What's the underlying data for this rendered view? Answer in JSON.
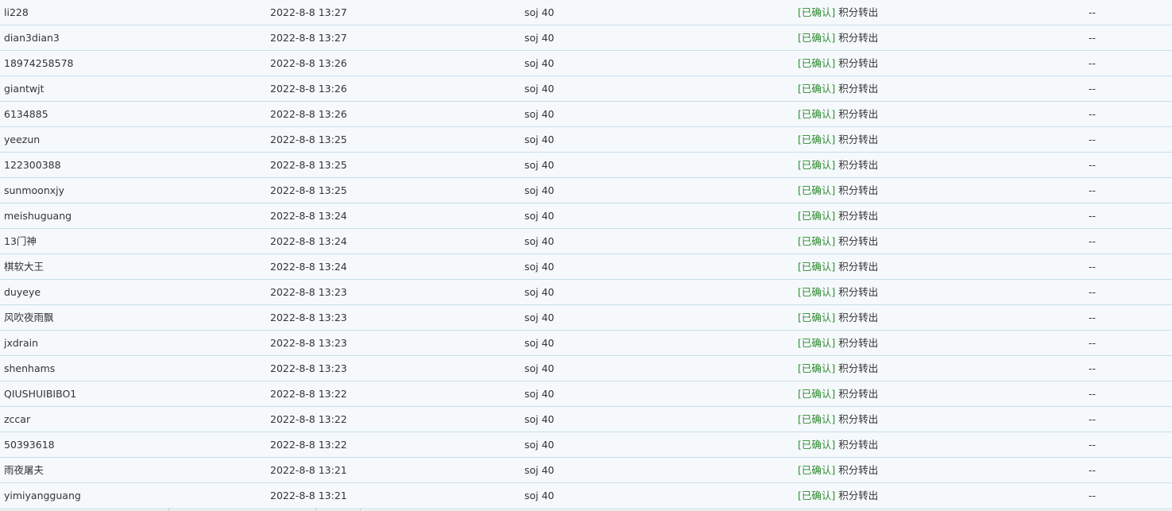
{
  "status_tag": "[已确认]",
  "status_type": "积分转出",
  "rows": [
    {
      "user": "li228",
      "time": "2022-8-8 13:27",
      "amount": "soj 40",
      "extra": "--"
    },
    {
      "user": "dian3dian3",
      "time": "2022-8-8 13:27",
      "amount": "soj 40",
      "extra": "--"
    },
    {
      "user": "18974258578",
      "time": "2022-8-8 13:26",
      "amount": "soj 40",
      "extra": "--"
    },
    {
      "user": "giantwjt",
      "time": "2022-8-8 13:26",
      "amount": "soj 40",
      "extra": "--"
    },
    {
      "user": "6134885",
      "time": "2022-8-8 13:26",
      "amount": "soj 40",
      "extra": "--"
    },
    {
      "user": "yeezun",
      "time": "2022-8-8 13:25",
      "amount": "soj 40",
      "extra": "--"
    },
    {
      "user": "122300388",
      "time": "2022-8-8 13:25",
      "amount": "soj 40",
      "extra": "--"
    },
    {
      "user": "sunmoonxjy",
      "time": "2022-8-8 13:25",
      "amount": "soj 40",
      "extra": "--"
    },
    {
      "user": "meishuguang",
      "time": "2022-8-8 13:24",
      "amount": "soj 40",
      "extra": "--"
    },
    {
      "user": "13门神",
      "time": "2022-8-8 13:24",
      "amount": "soj 40",
      "extra": "--"
    },
    {
      "user": "棋软大王",
      "time": "2022-8-8 13:24",
      "amount": "soj 40",
      "extra": "--"
    },
    {
      "user": "duyeye",
      "time": "2022-8-8 13:23",
      "amount": "soj 40",
      "extra": "--"
    },
    {
      "user": "风吹夜雨飘",
      "time": "2022-8-8 13:23",
      "amount": "soj 40",
      "extra": "--"
    },
    {
      "user": "jxdrain",
      "time": "2022-8-8 13:23",
      "amount": "soj 40",
      "extra": "--"
    },
    {
      "user": "shenhams",
      "time": "2022-8-8 13:23",
      "amount": "soj 40",
      "extra": "--"
    },
    {
      "user": "QIUSHUIBIBO1",
      "time": "2022-8-8 13:22",
      "amount": "soj 40",
      "extra": "--"
    },
    {
      "user": "zccar",
      "time": "2022-8-8 13:22",
      "amount": "soj 40",
      "extra": "--"
    },
    {
      "user": "50393618",
      "time": "2022-8-8 13:22",
      "amount": "soj 40",
      "extra": "--"
    },
    {
      "user": "雨夜屠夫",
      "time": "2022-8-8 13:21",
      "amount": "soj 40",
      "extra": "--"
    },
    {
      "user": "yimiyangguang",
      "time": "2022-8-8 13:21",
      "amount": "soj 40",
      "extra": "--"
    }
  ]
}
